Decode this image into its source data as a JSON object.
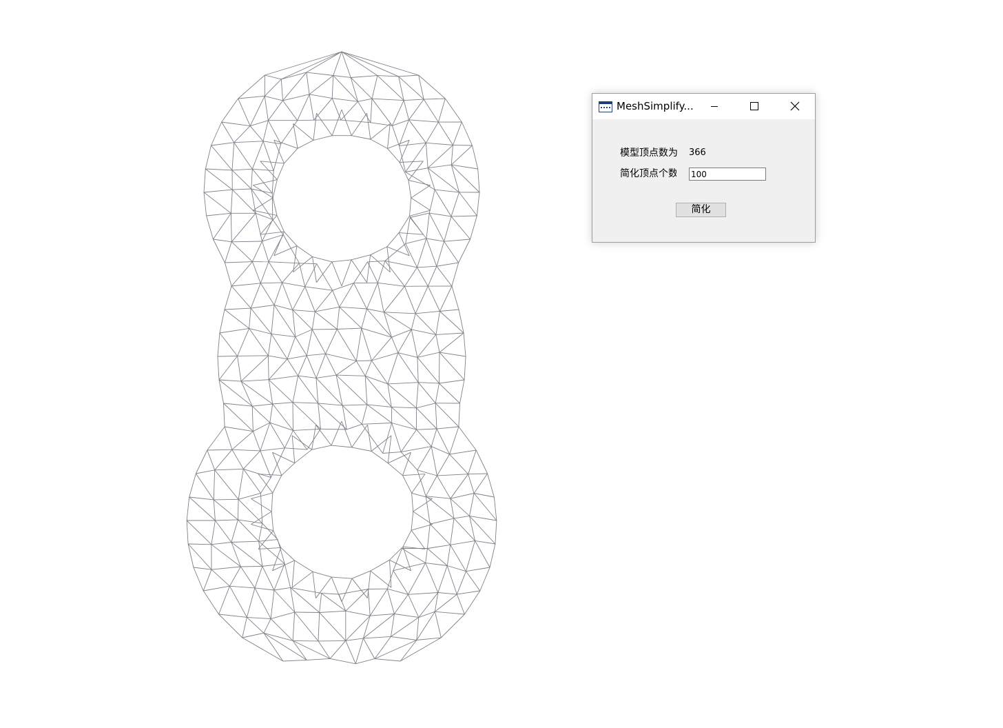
{
  "viewport": {
    "mesh_stroke_color": "#7f7f8a",
    "background_color": "#ffffff"
  },
  "dialog": {
    "title": "MeshSimplify...",
    "icon": "app-window-icon",
    "window_buttons": [
      "minimize-icon",
      "maximize-icon",
      "close-icon"
    ],
    "vertex_count_label": "模型顶点数为",
    "vertex_count_value": "366",
    "simplify_count_label": "简化顶点个数",
    "simplify_count_input": "100",
    "simplify_button_label": "简化",
    "accent_color": "#7da2ce"
  }
}
